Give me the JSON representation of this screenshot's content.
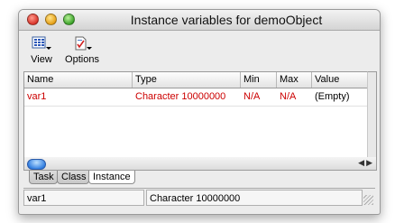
{
  "window": {
    "title": "Instance variables for demoObject"
  },
  "toolbar": {
    "view_label": "View",
    "options_label": "Options",
    "view_icon": "grid-view-icon",
    "options_icon": "document-options-icon"
  },
  "table": {
    "headers": [
      "Name",
      "Type",
      "Min",
      "Max",
      "Value"
    ],
    "rows": [
      {
        "name": "var1",
        "type": "Character   10000000",
        "min": "N/A",
        "max": "N/A",
        "value": "(Empty)"
      }
    ]
  },
  "tabs": [
    "Task",
    "Class",
    "Instance"
  ],
  "active_tab": "Instance",
  "status": {
    "name": "var1",
    "type": "Character   10000000"
  },
  "colors": {
    "row_text": "#cc0000",
    "scroll_thumb": "#2e7ce0"
  }
}
